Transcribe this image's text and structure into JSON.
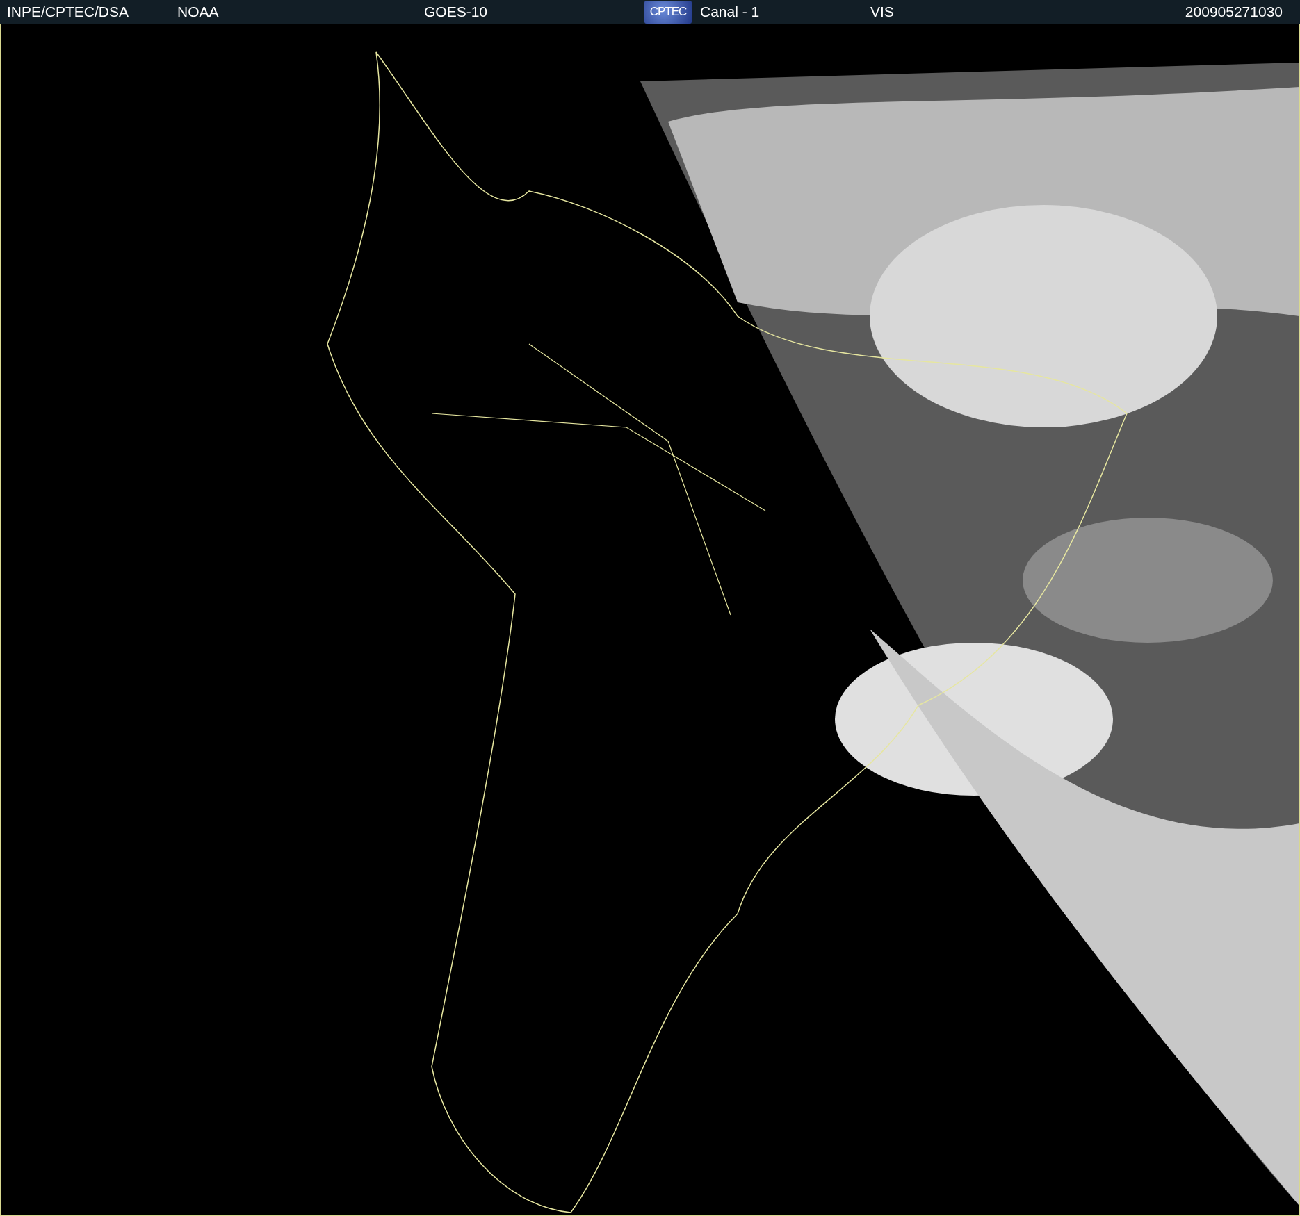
{
  "header": {
    "source": "INPE/CPTEC/DSA",
    "agency": "NOAA",
    "satellite": "GOES-10",
    "logo": "CPTEC",
    "channel": "Canal - 1",
    "band": "VIS",
    "timestamp": "200905271030"
  }
}
